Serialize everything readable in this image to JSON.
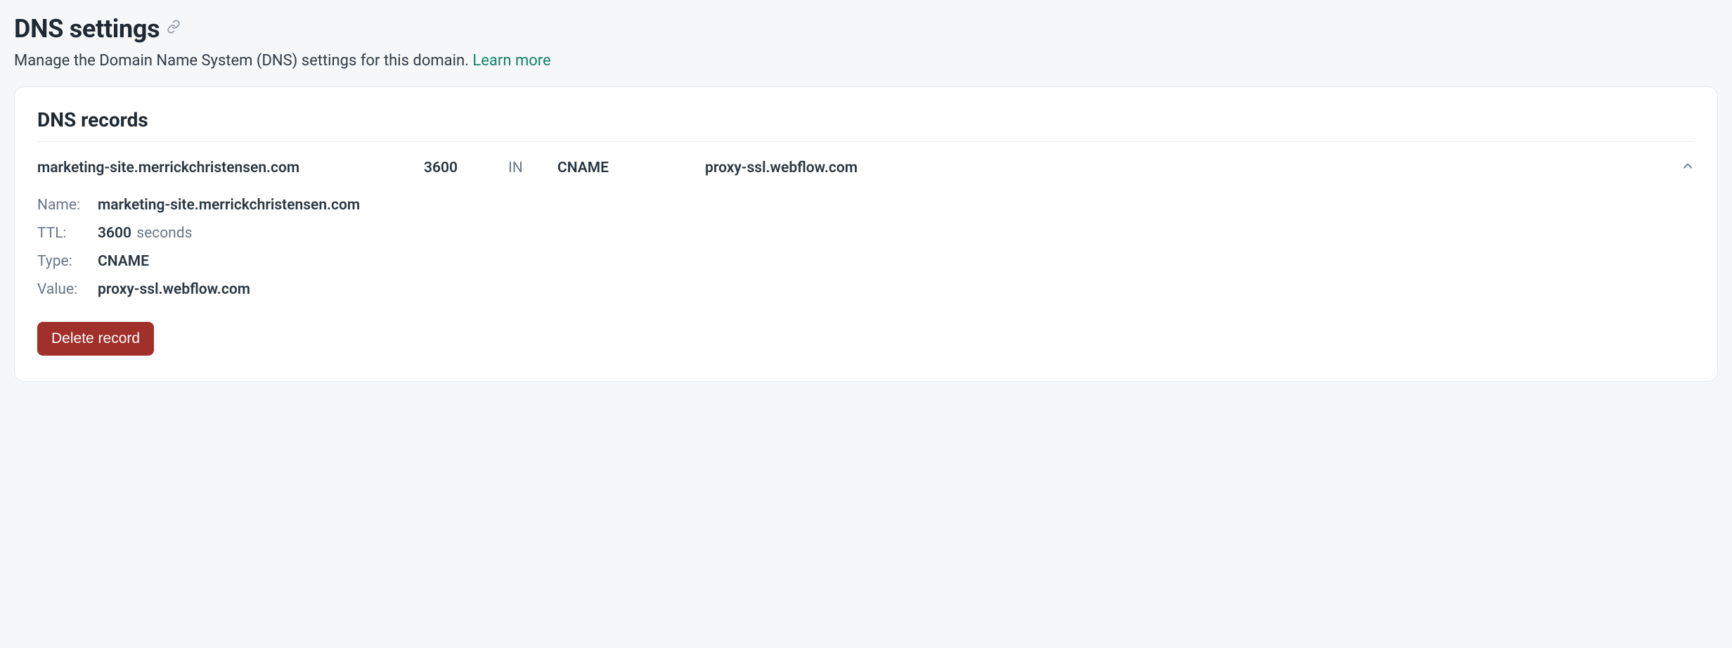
{
  "header": {
    "title": "DNS settings",
    "subtitle_prefix": "Manage the Domain Name System (DNS) settings for this domain.",
    "learn_more": "Learn more"
  },
  "card": {
    "title": "DNS records"
  },
  "record": {
    "summary": {
      "name": "marketing-site.merrickchristensen.com",
      "ttl": "3600",
      "class": "IN",
      "type": "CNAME",
      "value": "proxy-ssl.webflow.com"
    },
    "details": {
      "labels": {
        "name": "Name:",
        "ttl": "TTL:",
        "type": "Type:",
        "value": "Value:"
      },
      "name": "marketing-site.merrickchristensen.com",
      "ttl_value": "3600",
      "ttl_unit": "seconds",
      "type": "CNAME",
      "value": "proxy-ssl.webflow.com"
    },
    "delete_label": "Delete record"
  }
}
